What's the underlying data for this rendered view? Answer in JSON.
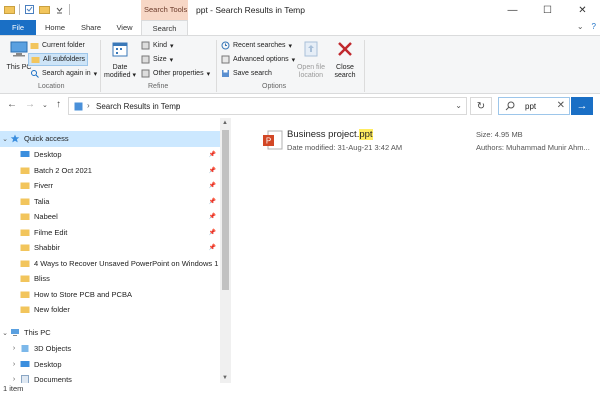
{
  "window": {
    "title": "ppt - Search Results in Temp",
    "contextual_group": "Search Tools",
    "controls": {
      "minimize": "—",
      "maximize": "☐",
      "close": "✕"
    }
  },
  "ribbon_tabs": {
    "file": "File",
    "home": "Home",
    "share": "Share",
    "view": "View",
    "search": "Search",
    "help": "?"
  },
  "ribbon": {
    "location": {
      "label": "Location",
      "this_pc": "This PC",
      "current_folder": "Current folder",
      "all_subfolders": "All subfolders",
      "search_again_in": "Search again in"
    },
    "refine": {
      "label": "Refine",
      "date_modified": "Date modified",
      "kind": "Kind",
      "size": "Size",
      "other_properties": "Other properties"
    },
    "options": {
      "label": "Options",
      "recent_searches": "Recent searches",
      "advanced_options": "Advanced options",
      "save_search": "Save search",
      "open_file_location": "Open file location",
      "close_search": "Close search"
    }
  },
  "address": {
    "breadcrumb": "Search Results in Temp",
    "search_query": "ppt"
  },
  "nav_pane": {
    "quick_access": "Quick access",
    "items": [
      {
        "label": "Desktop",
        "pinned": true,
        "icon": "desktop-icon"
      },
      {
        "label": "Batch 2 Oct 2021",
        "pinned": true,
        "icon": "folder-icon"
      },
      {
        "label": "Fiverr",
        "pinned": true,
        "icon": "folder-icon"
      },
      {
        "label": "Talia",
        "pinned": true,
        "icon": "folder-icon"
      },
      {
        "label": "Nabeel",
        "pinned": true,
        "icon": "folder-icon"
      },
      {
        "label": "Filme Edit",
        "pinned": true,
        "icon": "folder-icon"
      },
      {
        "label": "Shabbir",
        "pinned": true,
        "icon": "folder-icon"
      },
      {
        "label": "4 Ways to Recover Unsaved PowerPoint on Windows 1",
        "pinned": false,
        "icon": "folder-icon"
      },
      {
        "label": "Bliss",
        "pinned": false,
        "icon": "folder-icon"
      },
      {
        "label": "How to Store PCB and PCBA",
        "pinned": false,
        "icon": "folder-icon"
      },
      {
        "label": "New folder",
        "pinned": false,
        "icon": "folder-icon"
      }
    ],
    "this_pc": "This PC",
    "this_pc_items": [
      {
        "label": "3D Objects",
        "icon": "3d-objects-icon"
      },
      {
        "label": "Desktop",
        "icon": "desktop-icon"
      },
      {
        "label": "Documents",
        "icon": "documents-icon"
      }
    ]
  },
  "results": [
    {
      "name_prefix": "Business project.",
      "name_match": "ppt",
      "date_modified": "Date modified: 31-Aug-21 3:42 AM",
      "size": "Size: 4.95 MB",
      "authors": "Authors: Muhammad Munir Ahm..."
    }
  ],
  "status": {
    "item_count": "1 item"
  },
  "colors": {
    "accent": "#1a6fc5",
    "contextual_tab": "#f7d7c6",
    "selection": "#cce8ff",
    "search_highlight": "#ffec60"
  }
}
